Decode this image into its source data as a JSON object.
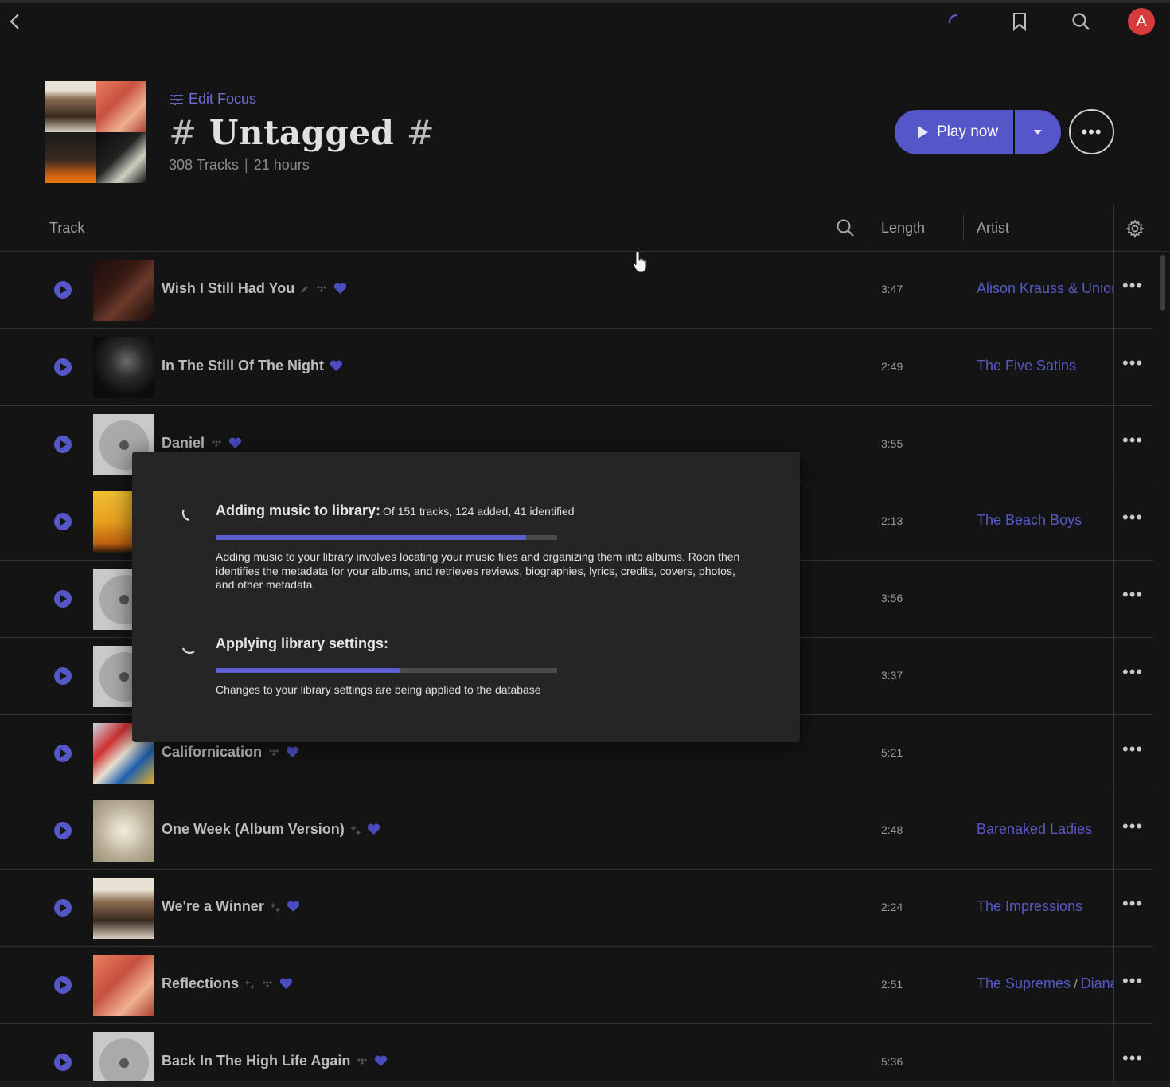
{
  "header": {
    "edit_focus": "Edit Focus",
    "title_hash_left": "#",
    "title": "Untagged",
    "title_hash_right": "#",
    "tracks": "308 Tracks",
    "separator": "|",
    "duration": "21 hours",
    "play_now": "Play now",
    "user_initial": "A"
  },
  "table": {
    "col_track": "Track",
    "col_length": "Length",
    "col_artist": "Artist"
  },
  "rows": [
    {
      "title": "Wish I Still Had You",
      "length": "3:47",
      "artist": "Alison Krauss & Union Station"
    },
    {
      "title": "In The Still Of The Night",
      "length": "2:49",
      "artist": "The Five Satins"
    },
    {
      "title": "Daniel",
      "length": "3:55",
      "artist": ""
    },
    {
      "title": "",
      "length": "2:13",
      "artist": "The Beach Boys"
    },
    {
      "title": "",
      "length": "3:56",
      "artist": ""
    },
    {
      "title": "",
      "length": "3:37",
      "artist": ""
    },
    {
      "title": "Californication",
      "length": "5:21",
      "artist": ""
    },
    {
      "title": "One Week (Album Version)",
      "length": "2:48",
      "artist": "Barenaked Ladies"
    },
    {
      "title": "We're a Winner",
      "length": "2:24",
      "artist": "The Impressions"
    },
    {
      "title": "Reflections",
      "length": "2:51",
      "artist": "The Supremes",
      "artist2": "Diana Ross"
    },
    {
      "title": "Back In The High Life Again",
      "length": "5:36",
      "artist": ""
    }
  ],
  "modal": {
    "task1_label": "Adding music to library:",
    "task1_detail": "Of 151 tracks, 124 added, 41 identified",
    "task1_progress": 0.91,
    "task1_text": "Adding music to your library involves locating your music files and organizing them into albums. Roon then identifies the metadata for your albums, and retrieves reviews, biographies, lyrics, credits, covers, photos, and other metadata.",
    "task2_label": "Applying library settings:",
    "task2_progress": 0.54,
    "task2_text": "Changes to your library settings are being applied to the database"
  },
  "colors": {
    "accent": "#5557c9",
    "background": "#141414",
    "modal": "#252525",
    "avatar": "#d63a3a"
  }
}
